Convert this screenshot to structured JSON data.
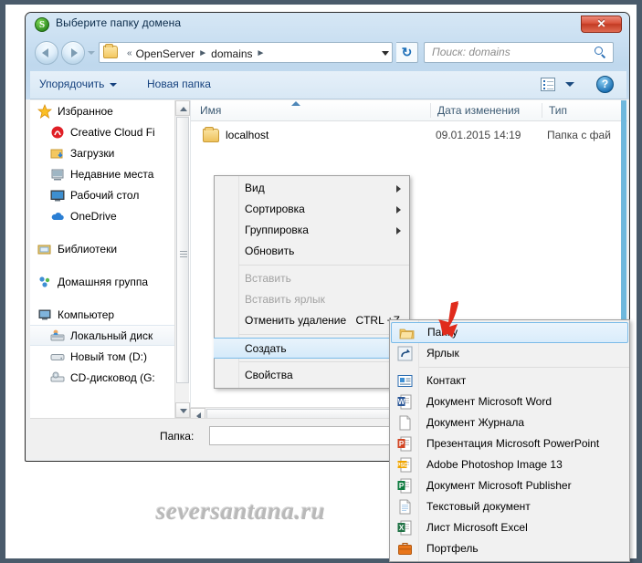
{
  "window": {
    "title": "Выберите папку домена",
    "app_icon": "S",
    "close_label": "✕"
  },
  "addressbar": {
    "prefix": "«",
    "crumbs": [
      "OpenServer",
      "domains"
    ],
    "separator": "►",
    "refresh_icon": "↻"
  },
  "search": {
    "placeholder": "Поиск: domains"
  },
  "commandbar": {
    "organize": "Упорядочить",
    "new_folder": "Новая папка",
    "help": "?"
  },
  "sidebar": {
    "groups": [
      {
        "label": "Избранное",
        "icon": "star-icon",
        "items": [
          {
            "label": "Creative Cloud Fi",
            "icon": "creative-cloud-icon"
          },
          {
            "label": "Загрузки",
            "icon": "downloads-icon"
          },
          {
            "label": "Недавние места",
            "icon": "recent-places-icon"
          },
          {
            "label": "Рабочий стол",
            "icon": "desktop-icon"
          },
          {
            "label": "OneDrive",
            "icon": "onedrive-icon"
          }
        ]
      },
      {
        "label": "Библиотеки",
        "icon": "libraries-icon",
        "items": []
      },
      {
        "label": "Домашняя группа",
        "icon": "homegroup-icon",
        "items": []
      },
      {
        "label": "Компьютер",
        "icon": "computer-icon",
        "items": [
          {
            "label": "Локальный диск",
            "icon": "local-disk-icon",
            "selected": true
          },
          {
            "label": "Новый том (D:)",
            "icon": "drive-icon"
          },
          {
            "label": "CD-дисковод (G:",
            "icon": "cd-drive-icon"
          }
        ]
      }
    ]
  },
  "filelist": {
    "columns": [
      "Имя",
      "Дата изменения",
      "Тип"
    ],
    "rows": [
      {
        "name": "localhost",
        "date": "09.01.2015 14:19",
        "type": "Папка с фай",
        "icon": "folder-icon"
      }
    ]
  },
  "bottombar": {
    "folder_label": "Папка:",
    "folder_value": "",
    "folder_placeholder": ""
  },
  "context_menu": {
    "items": [
      {
        "label": "Вид",
        "submenu": true,
        "disabled": false
      },
      {
        "label": "Сортировка",
        "submenu": true,
        "disabled": false
      },
      {
        "label": "Группировка",
        "submenu": true,
        "disabled": false
      },
      {
        "label": "Обновить",
        "submenu": false,
        "disabled": false
      },
      {
        "separator": true
      },
      {
        "label": "Вставить",
        "submenu": false,
        "disabled": true
      },
      {
        "label": "Вставить ярлык",
        "submenu": false,
        "disabled": true
      },
      {
        "label": "Отменить удаление",
        "submenu": false,
        "disabled": false,
        "shortcut": "CTRL +Z"
      },
      {
        "separator": true
      },
      {
        "label": "Создать",
        "submenu": true,
        "disabled": false,
        "highlight": true
      },
      {
        "separator": true
      },
      {
        "label": "Свойства",
        "submenu": false,
        "disabled": false
      }
    ]
  },
  "submenu": {
    "items": [
      {
        "label": "Папку",
        "icon": "folder-icon",
        "highlight": true
      },
      {
        "label": "Ярлык",
        "icon": "shortcut-icon"
      },
      {
        "separator": true
      },
      {
        "label": "Контакт",
        "icon": "contact-icon"
      },
      {
        "label": "Документ Microsoft Word",
        "icon": "word-icon",
        "badge": "W",
        "badge_color": "#2b5797"
      },
      {
        "label": "Документ Журнала",
        "icon": "journal-icon"
      },
      {
        "label": "Презентация Microsoft PowerPoint",
        "icon": "powerpoint-icon",
        "badge": "P",
        "badge_color": "#d24726"
      },
      {
        "label": "Adobe Photoshop Image 13",
        "icon": "photoshop-icon",
        "badge": "PSD",
        "badge_color": "#f0a500"
      },
      {
        "label": "Документ Microsoft Publisher",
        "icon": "publisher-icon",
        "badge": "P",
        "badge_color": "#107c41"
      },
      {
        "label": "Текстовый документ",
        "icon": "text-document-icon"
      },
      {
        "label": "Лист Microsoft Excel",
        "icon": "excel-icon",
        "badge": "X",
        "badge_color": "#217346"
      },
      {
        "label": "Портфель",
        "icon": "briefcase-icon"
      }
    ]
  },
  "annotation": {
    "arrow_color": "#e02b1c",
    "target": "Папку"
  },
  "watermark": {
    "text": "seversantana.ru"
  }
}
